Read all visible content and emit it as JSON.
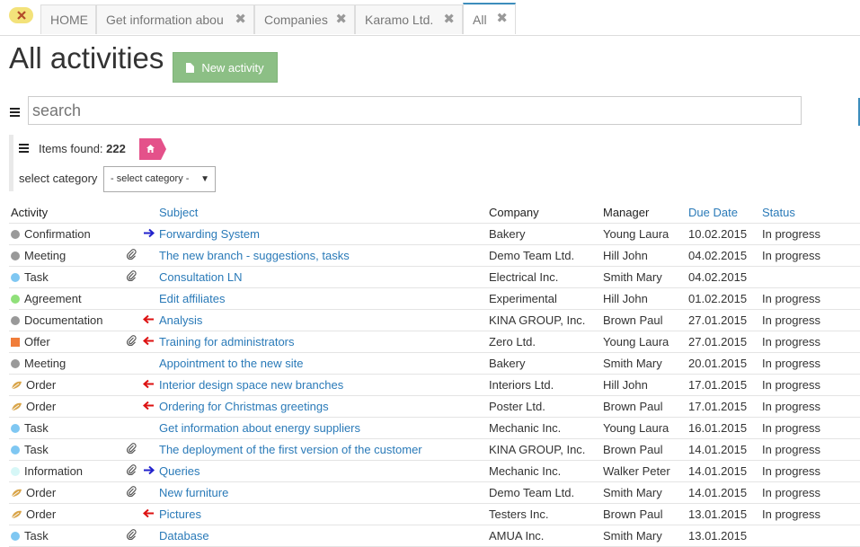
{
  "tabs": [
    {
      "label": "HOME",
      "close": false
    },
    {
      "label": "Get information abou",
      "close": true
    },
    {
      "label": "Companies",
      "close": true
    },
    {
      "label": "Karamo Ltd.",
      "close": true
    },
    {
      "label": "All",
      "close": true,
      "active": true
    }
  ],
  "page": {
    "title": "All activities",
    "new_button": "New activity"
  },
  "search": {
    "placeholder": "search"
  },
  "filter": {
    "items_found_label": "Items found:",
    "items_found_count": "222",
    "category_label": "select category",
    "category_value": "- select category -"
  },
  "table": {
    "headers": {
      "activity": "Activity",
      "subject": "Subject",
      "company": "Company",
      "manager": "Manager",
      "due": "Due Date",
      "status": "Status"
    },
    "rows": [
      {
        "activity": "Confirmation",
        "icon": "dot",
        "color": "#999999",
        "clip": false,
        "arrow": "right",
        "subject": "Forwarding System",
        "company": "Bakery",
        "manager": "Young Laura",
        "due": "10.02.2015",
        "status": "In progress"
      },
      {
        "activity": "Meeting",
        "icon": "dot",
        "color": "#999999",
        "clip": true,
        "arrow": "",
        "subject": "The new branch - suggestions, tasks",
        "company": "Demo Team Ltd.",
        "manager": "Hill John",
        "due": "04.02.2015",
        "status": "In progress"
      },
      {
        "activity": "Task",
        "icon": "dot",
        "color": "#7fc7f2",
        "clip": true,
        "arrow": "",
        "subject": "Consultation LN",
        "company": "Electrical Inc.",
        "manager": "Smith Mary",
        "due": "04.02.2015",
        "status": ""
      },
      {
        "activity": "Agreement",
        "icon": "dot",
        "color": "#90e07a",
        "clip": false,
        "arrow": "",
        "subject": "Edit affiliates",
        "company": "Experimental",
        "manager": "Hill John",
        "due": "01.02.2015",
        "status": "In progress"
      },
      {
        "activity": "Documentation",
        "icon": "dot",
        "color": "#999999",
        "clip": false,
        "arrow": "left",
        "subject": "Analysis",
        "company": "KINA GROUP, Inc.",
        "manager": "Brown Paul",
        "due": "27.01.2015",
        "status": "In progress"
      },
      {
        "activity": "Offer",
        "icon": "square",
        "color": "#f07d3a",
        "clip": true,
        "arrow": "left",
        "subject": "Training for administrators",
        "company": "Zero Ltd.",
        "manager": "Young Laura",
        "due": "27.01.2015",
        "status": "In progress"
      },
      {
        "activity": "Meeting",
        "icon": "dot",
        "color": "#999999",
        "clip": false,
        "arrow": "",
        "subject": "Appointment to the new site",
        "company": "Bakery",
        "manager": "Smith Mary",
        "due": "20.01.2015",
        "status": "In progress"
      },
      {
        "activity": "Order",
        "icon": "leaf",
        "color": "#d9a54a",
        "clip": false,
        "arrow": "left",
        "subject": "Interior design space new branches",
        "company": "Interiors Ltd.",
        "manager": "Hill John",
        "due": "17.01.2015",
        "status": "In progress"
      },
      {
        "activity": "Order",
        "icon": "leaf",
        "color": "#d9a54a",
        "clip": false,
        "arrow": "left",
        "subject": "Ordering for Christmas greetings",
        "company": "Poster Ltd.",
        "manager": "Brown Paul",
        "due": "17.01.2015",
        "status": "In progress"
      },
      {
        "activity": "Task",
        "icon": "dot",
        "color": "#7fc7f2",
        "clip": false,
        "arrow": "",
        "subject": "Get information about energy suppliers",
        "company": "Mechanic Inc.",
        "manager": "Young Laura",
        "due": "16.01.2015",
        "status": "In progress"
      },
      {
        "activity": "Task",
        "icon": "dot",
        "color": "#7fc7f2",
        "clip": true,
        "arrow": "",
        "subject": "The deployment of the first version of the customer",
        "company": "KINA GROUP, Inc.",
        "manager": "Brown Paul",
        "due": "14.01.2015",
        "status": "In progress"
      },
      {
        "activity": "Information",
        "icon": "dot",
        "color": "#d6f7f7",
        "clip": true,
        "arrow": "right",
        "subject": "Queries",
        "company": "Mechanic Inc.",
        "manager": "Walker Peter",
        "due": "14.01.2015",
        "status": "In progress"
      },
      {
        "activity": "Order",
        "icon": "leaf",
        "color": "#d9a54a",
        "clip": true,
        "arrow": "",
        "subject": "New furniture",
        "company": "Demo Team Ltd.",
        "manager": "Smith Mary",
        "due": "14.01.2015",
        "status": "In progress"
      },
      {
        "activity": "Order",
        "icon": "leaf",
        "color": "#d9a54a",
        "clip": false,
        "arrow": "left",
        "subject": "Pictures",
        "company": "Testers Inc.",
        "manager": "Brown Paul",
        "due": "13.01.2015",
        "status": "In progress"
      },
      {
        "activity": "Task",
        "icon": "dot",
        "color": "#7fc7f2",
        "clip": true,
        "arrow": "",
        "subject": "Database",
        "company": "AMUA Inc.",
        "manager": "Smith Mary",
        "due": "13.01.2015",
        "status": ""
      }
    ]
  },
  "colors": {
    "accent": "#2a7ab8",
    "new_button": "#8cbf85",
    "home_badge": "#e4518a",
    "arrow_right": "#2222cc",
    "arrow_left": "#dd1111"
  }
}
